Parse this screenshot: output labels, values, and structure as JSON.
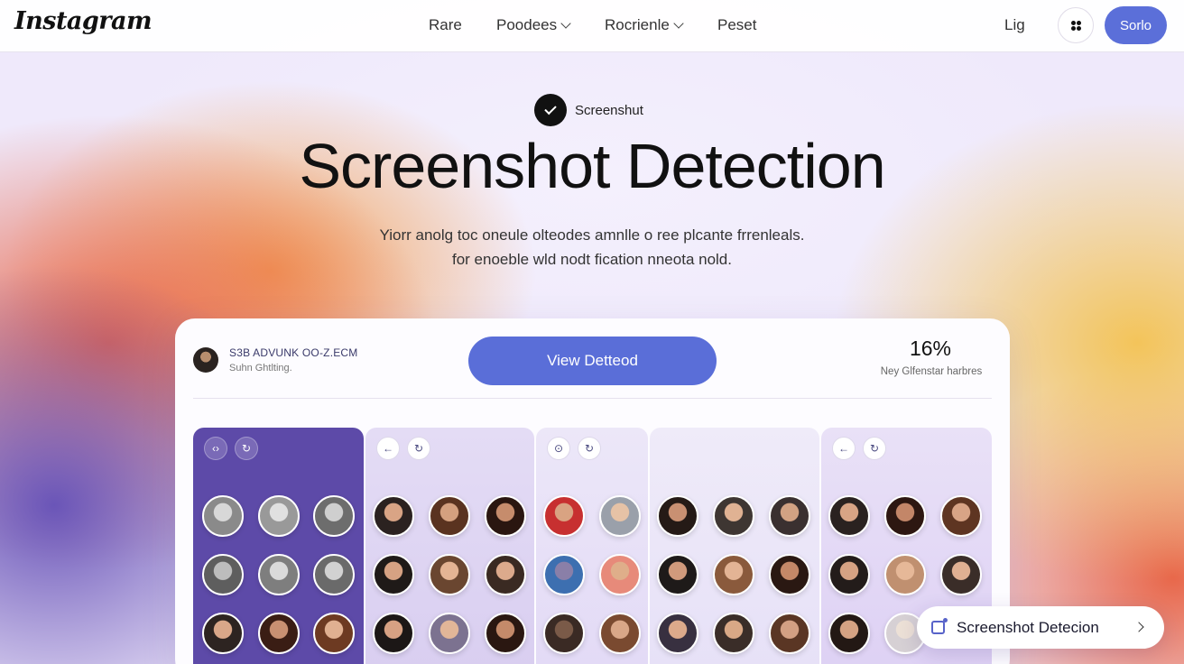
{
  "nav": {
    "logo": "Instagram",
    "links": [
      {
        "label": "Rare",
        "has_dropdown": false
      },
      {
        "label": "Poodees",
        "has_dropdown": true
      },
      {
        "label": "Rocrienle",
        "has_dropdown": true
      },
      {
        "label": "Peset",
        "has_dropdown": false
      }
    ],
    "login": "Lig",
    "icon_button": "clover-icon",
    "signup": "Sorlo",
    "accent_color": "#5b6fd9"
  },
  "hero": {
    "badge_text": "Screenshut",
    "title": "Screenshot Detection",
    "subtitle_line1": "Yiorr anolg toc oneule olteodes amnlle o ree plcante frrenleals.",
    "subtitle_line2": "for enoeble wld nodt fication nneota nold."
  },
  "card": {
    "account_handle": "S3B ADVUNK OO-Z.ECM",
    "account_sub": "Suhn Ghtlting.",
    "view_button": "View Detteod",
    "stat_value": "16%",
    "stat_label": "Ney Glfenstar harbres",
    "columns": [
      {
        "tools": [
          "‹›",
          "↻"
        ],
        "theme": "dark"
      },
      {
        "tools": [
          "←",
          "↻"
        ],
        "theme": "light"
      },
      {
        "tools": [
          "⊙",
          "↻"
        ],
        "theme": "light"
      },
      {
        "tools": [],
        "theme": "light"
      },
      {
        "tools": [
          "←",
          "↻"
        ],
        "theme": "light"
      }
    ]
  },
  "toast": {
    "label": "Screenshot Detecion",
    "icon": "detect-icon"
  }
}
